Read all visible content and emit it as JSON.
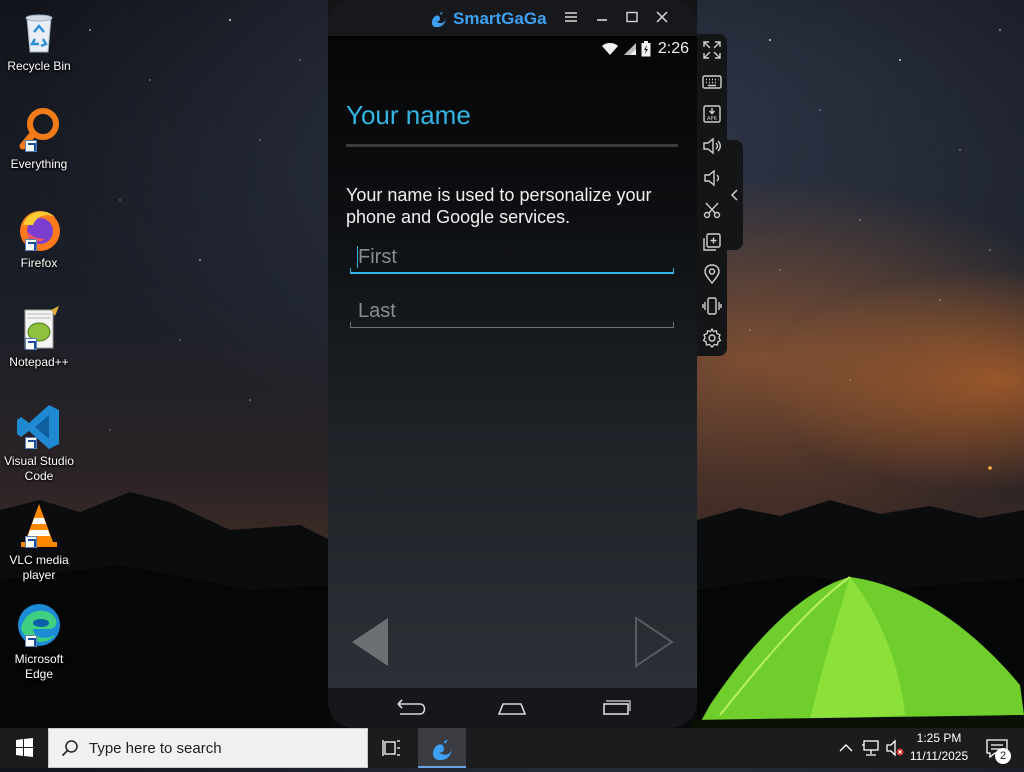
{
  "desktop": {
    "icons": [
      {
        "label": "Recycle Bin"
      },
      {
        "label": "Everything"
      },
      {
        "label": "Firefox"
      },
      {
        "label": "Notepad++"
      },
      {
        "label": "Visual Studio Code"
      },
      {
        "label": "VLC media player"
      },
      {
        "label": "Microsoft Edge"
      }
    ]
  },
  "emulator": {
    "title": "SmartGaGa",
    "window_controls": [
      "menu-icon",
      "minimize-icon",
      "maximize-icon",
      "close-icon"
    ],
    "status": {
      "time": "2:26",
      "icons": [
        "wifi-icon",
        "signal-icon",
        "battery-icon"
      ]
    },
    "setup": {
      "title": "Your name",
      "description": "Your name is used to personalize your phone and Google services.",
      "first": {
        "placeholder": "First",
        "value": ""
      },
      "last": {
        "placeholder": "Last",
        "value": ""
      }
    },
    "nav_buttons": [
      "back-arrow-icon",
      "next-arrow-icon"
    ],
    "android_nav": [
      "android-back-icon",
      "android-home-icon",
      "android-recents-icon"
    ],
    "sidebar_tools": [
      "fullscreen-icon",
      "keyboard-icon",
      "install-apk-icon",
      "volume-up-icon",
      "volume-down-icon",
      "screenshot-scissors-icon",
      "multi-instance-icon",
      "location-icon",
      "shake-icon",
      "settings-gear-icon"
    ],
    "accent_color": "#33b5e5"
  },
  "taskbar": {
    "search_placeholder": "Type here to search",
    "clock_time": "1:25 PM",
    "clock_date": "11/11/2025",
    "notification_count": "2"
  }
}
